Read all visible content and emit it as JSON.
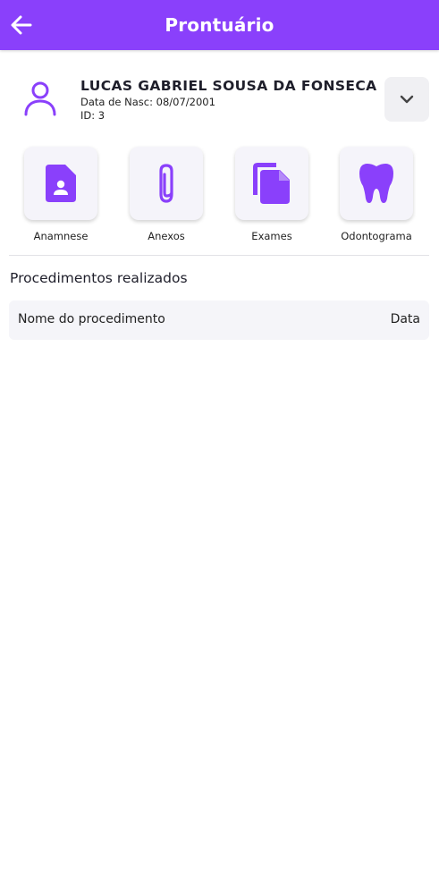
{
  "header": {
    "title": "Prontuário",
    "back_icon": "arrow-left-icon",
    "bg_color": "#8a40fb"
  },
  "patient": {
    "name": "LUCAS GABRIEL SOUSA DA FONSECA",
    "birth": "Data de Nasc: 08/07/2001",
    "id": "ID: 3",
    "avatar_icon": "person-outline-icon",
    "expand_icon": "chevron-down-icon"
  },
  "shortcuts": [
    {
      "label": "Anamnese",
      "icon": "contact-file-icon"
    },
    {
      "label": "Anexos",
      "icon": "paperclip-icon"
    },
    {
      "label": "Exames",
      "icon": "copy-files-icon"
    },
    {
      "label": "Odontograma",
      "icon": "tooth-icon"
    }
  ],
  "procedures": {
    "title": "Procedimentos realizados",
    "columns": [
      "Nome do procedimento",
      "Data"
    ],
    "rows": []
  },
  "colors": {
    "accent": "#8a40fb",
    "card_bg": "#f5f4fa"
  }
}
